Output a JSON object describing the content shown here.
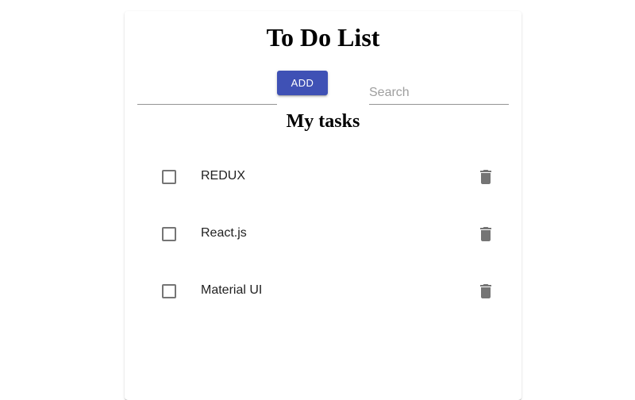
{
  "app": {
    "title": "To Do List",
    "add_button_label": "ADD",
    "task_input_value": "",
    "search_placeholder": "Search",
    "search_value": "",
    "section_title": "My tasks"
  },
  "tasks": [
    {
      "label": "REDUX",
      "checked": false
    },
    {
      "label": "React.js",
      "checked": false
    },
    {
      "label": "Material UI",
      "checked": false
    }
  ],
  "icons": {
    "checkbox": "checkbox-outline-icon",
    "delete": "trash-icon"
  },
  "colors": {
    "primary": "#3f51b5",
    "icon": "#757575",
    "text": "#212121"
  }
}
